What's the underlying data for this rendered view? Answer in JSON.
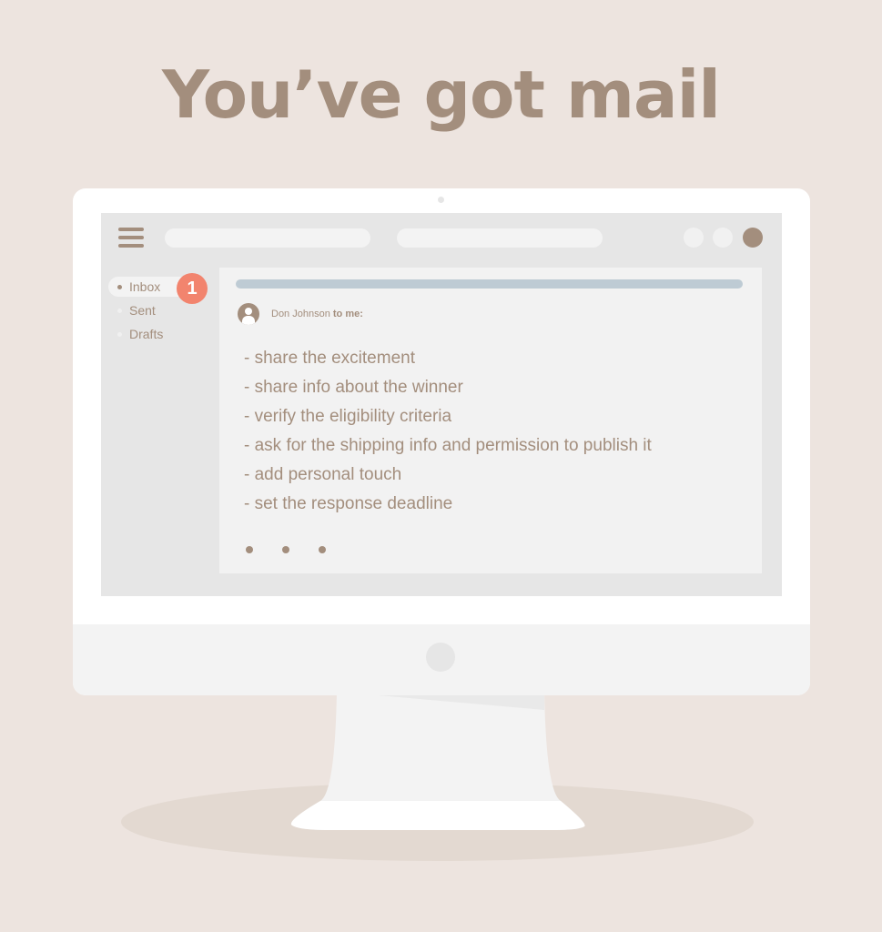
{
  "title": "You’ve got mail",
  "toolbar": {
    "menu_icon": "hamburger-icon",
    "search_bars": 2,
    "status_circles": [
      "light",
      "light",
      "accent"
    ]
  },
  "sidebar": {
    "items": [
      {
        "label": "Inbox",
        "active": true,
        "badge": "1"
      },
      {
        "label": "Sent",
        "active": false
      },
      {
        "label": "Drafts",
        "active": false
      }
    ]
  },
  "email": {
    "sender": "Don Johnson",
    "recipient_text": "to me:",
    "lines": [
      "- share the excitement",
      "- share info about the winner",
      "- verify the eligibility criteria",
      "- ask for the shipping info and permission to publish it",
      "- add personal touch",
      "- set the response deadline"
    ],
    "ellipsis_icon": "more-dots-icon"
  },
  "colors": {
    "background": "#ede4df",
    "accent": "#a38e7d",
    "badge": "#f2846e",
    "subject_bar": "#becbd4"
  }
}
